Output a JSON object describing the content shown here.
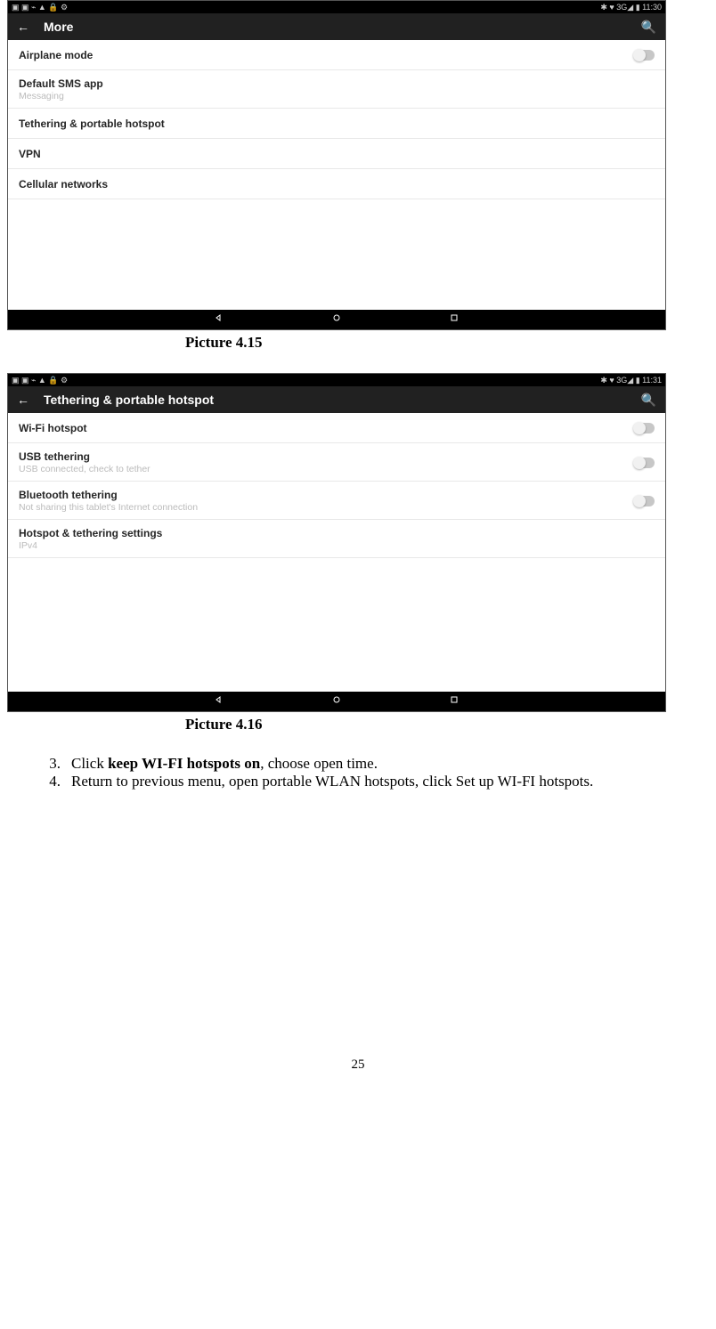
{
  "shot1": {
    "status": {
      "left_glyphs": "▣ ▣ ⌁ ▲ 🔒 ⚙",
      "right_text": "✱ ♥ 3G◢ ▮ 11:30"
    },
    "actionbar": {
      "back_glyph": "←",
      "title": "More",
      "search_glyph": "🔍"
    },
    "items": [
      {
        "primary": "Airplane mode",
        "toggle": true
      },
      {
        "primary": "Default SMS app",
        "secondary": "Messaging"
      },
      {
        "primary": "Tethering & portable hotspot"
      },
      {
        "primary": "VPN"
      },
      {
        "primary": "Cellular networks"
      }
    ]
  },
  "caption1": "Picture 4.15",
  "shot2": {
    "status": {
      "left_glyphs": "▣ ▣ ⌁ ▲ 🔒 ⚙",
      "right_text": "✱ ♥ 3G◢ ▮ 11:31"
    },
    "actionbar": {
      "back_glyph": "←",
      "title": "Tethering & portable hotspot",
      "search_glyph": "🔍"
    },
    "items": [
      {
        "primary": "Wi-Fi hotspot",
        "toggle": true
      },
      {
        "primary": "USB tethering",
        "secondary": "USB connected, check to tether",
        "toggle": true
      },
      {
        "primary": "Bluetooth tethering",
        "secondary": "Not sharing this tablet's Internet connection",
        "toggle": true
      },
      {
        "primary": "Hotspot & tethering settings",
        "secondary": "IPv4"
      }
    ]
  },
  "caption2": "Picture 4.16",
  "list_items": {
    "n3": "3.",
    "t3_a": "Click ",
    "t3_b": "keep WI-FI hotspots on",
    "t3_c": ", choose open time.",
    "n4": "4.",
    "t4": "Return to previous menu, open portable WLAN hotspots, click Set up WI-FI hotspots."
  },
  "page_number": "25"
}
